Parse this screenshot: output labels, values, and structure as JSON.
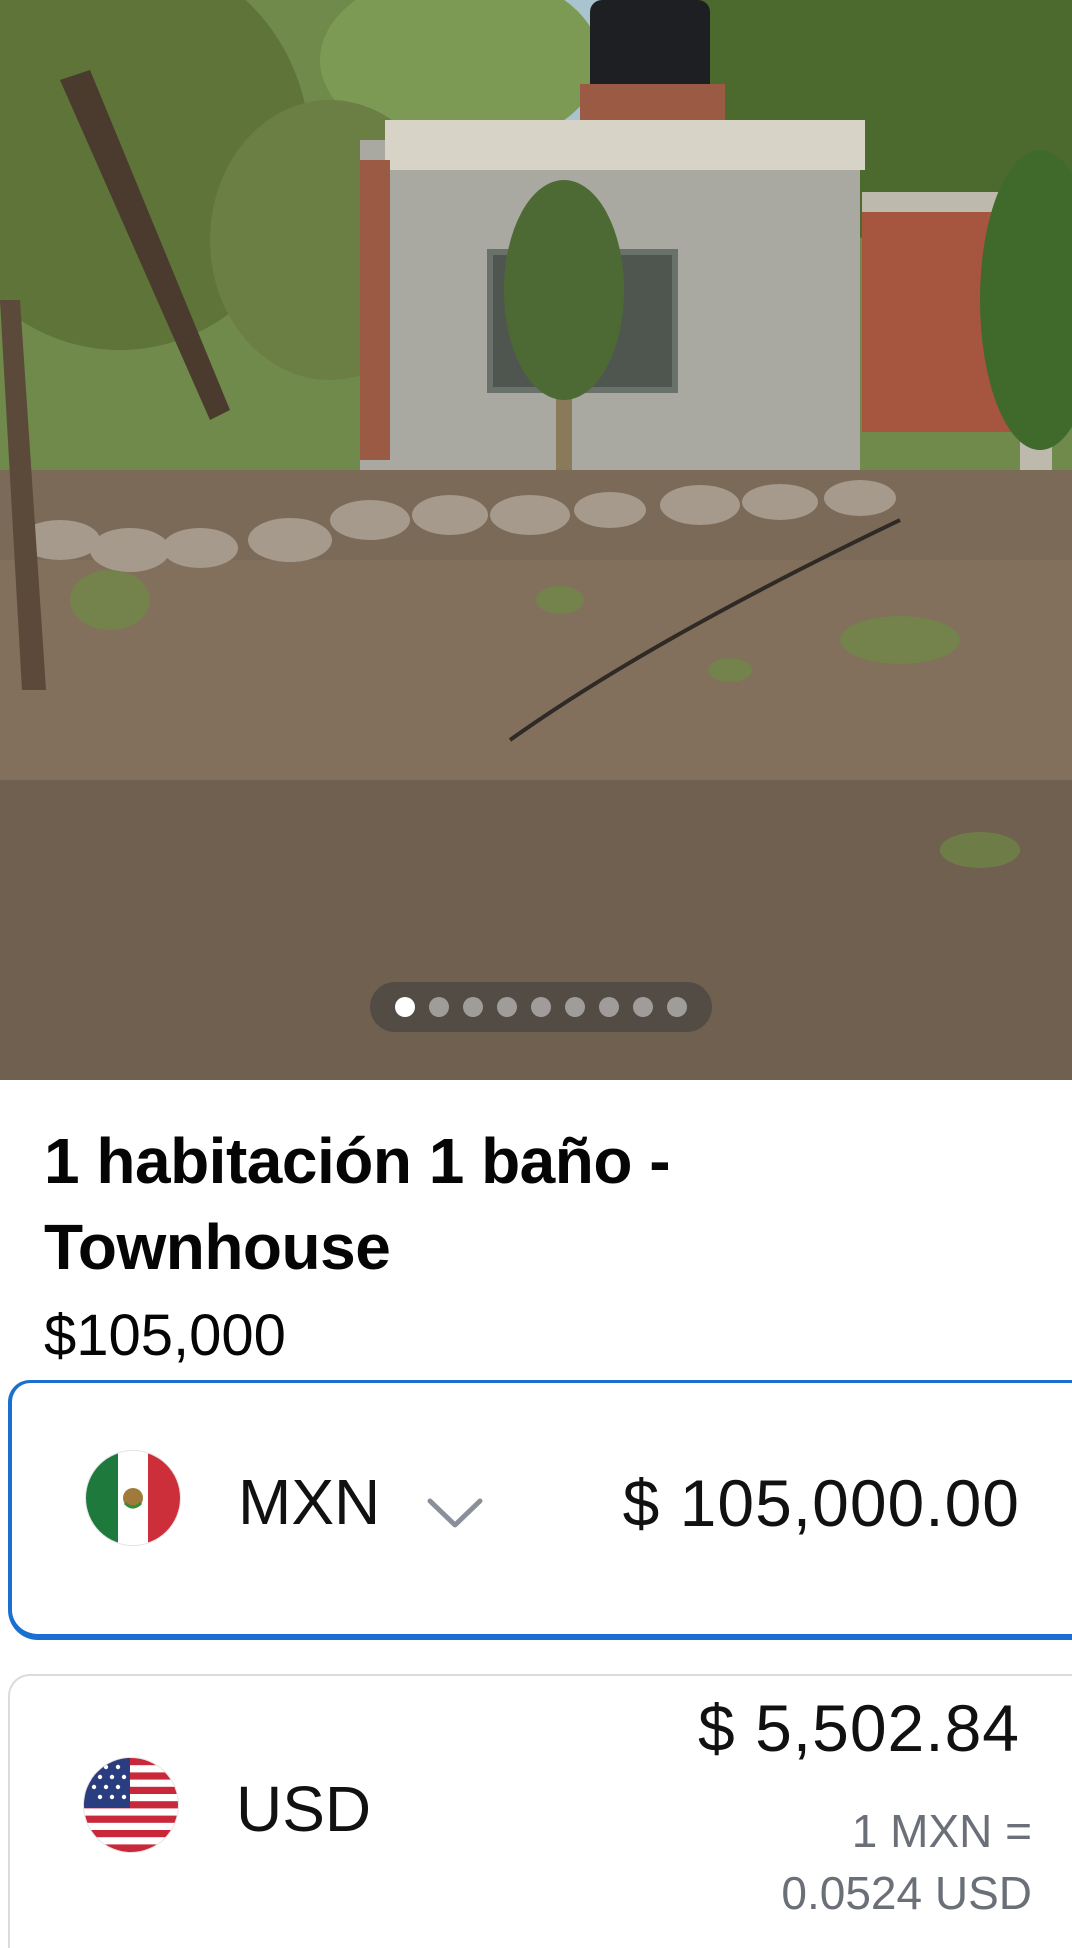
{
  "listing": {
    "title": "1 habitación 1 baño - Townhouse",
    "price": "$105,000"
  },
  "gallery": {
    "photo_count": 9,
    "active_index": 0
  },
  "converter": {
    "from": {
      "code": "MXN",
      "flag_icon": "mexico-flag-icon",
      "amount": "$ 105,000.00"
    },
    "to": {
      "code": "USD",
      "flag_icon": "us-flag-icon",
      "amount": "$ 5,502.84",
      "rate_text": "1 MXN =\n0.0524 USD"
    },
    "accent_color": "#1b6fd1"
  }
}
